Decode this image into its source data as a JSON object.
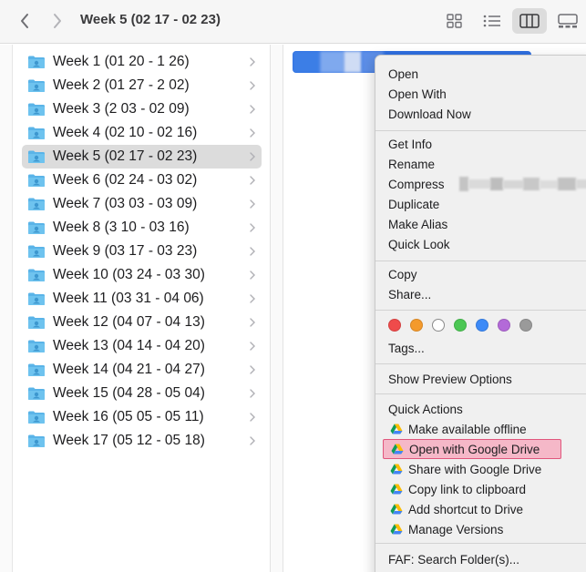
{
  "toolbar": {
    "title": "Week 5 (02 17 - 02 23)",
    "back_icon": "chevron-left-icon",
    "forward_icon": "chevron-right-icon",
    "view_modes": [
      "icon-view-icon",
      "list-view-icon",
      "column-view-icon",
      "gallery-view-icon"
    ],
    "active_view": "column-view-icon"
  },
  "folders": [
    {
      "label": "Week 1 (01 20 - 1 26)",
      "selected": false
    },
    {
      "label": "Week 2 (01 27 - 2 02)",
      "selected": false
    },
    {
      "label": "Week 3 (2 03 - 02 09)",
      "selected": false
    },
    {
      "label": "Week 4 (02 10 - 02 16)",
      "selected": false
    },
    {
      "label": "Week 5 (02 17 - 02 23)",
      "selected": true
    },
    {
      "label": "Week 6 (02 24 - 03 02)",
      "selected": false
    },
    {
      "label": "Week 7 (03 03 - 03 09)",
      "selected": false
    },
    {
      "label": "Week 8 (3 10 - 03 16)",
      "selected": false
    },
    {
      "label": "Week 9 (03 17 - 03 23)",
      "selected": false
    },
    {
      "label": "Week 10 (03 24 - 03 30)",
      "selected": false
    },
    {
      "label": "Week 11 (03 31 - 04 06)",
      "selected": false
    },
    {
      "label": "Week 12 (04 07 - 04 13)",
      "selected": false
    },
    {
      "label": "Week 13 (04 14 - 04 20)",
      "selected": false
    },
    {
      "label": "Week 14 (04 21 - 04 27)",
      "selected": false
    },
    {
      "label": "Week 15 (04 28 - 05 04)",
      "selected": false
    },
    {
      "label": "Week 16 (05 05 - 05 11)",
      "selected": false
    },
    {
      "label": "Week 17 (05 12 - 05 18)",
      "selected": false
    }
  ],
  "menu": {
    "open": "Open",
    "open_with": "Open With",
    "download_now": "Download Now",
    "get_info": "Get Info",
    "rename": "Rename",
    "compress": "Compress",
    "duplicate": "Duplicate",
    "make_alias": "Make Alias",
    "quick_look": "Quick Look",
    "copy": "Copy",
    "share": "Share...",
    "tags": "Tags...",
    "show_preview_options": "Show Preview Options",
    "quick_actions_title": "Quick Actions",
    "quick_actions": [
      {
        "label": "Make available offline",
        "highlighted": false
      },
      {
        "label": "Open with Google Drive",
        "highlighted": true
      },
      {
        "label": "Share with Google Drive",
        "highlighted": false
      },
      {
        "label": "Copy link to clipboard",
        "highlighted": false
      },
      {
        "label": "Add shortcut to Drive",
        "highlighted": false
      },
      {
        "label": "Manage Versions",
        "highlighted": false
      }
    ],
    "faf_search": "FAF: Search Folder(s)..."
  },
  "tag_colors": [
    {
      "name": "red",
      "color": "#ef4b4b"
    },
    {
      "name": "orange",
      "color": "#f49a2c"
    },
    {
      "name": "none",
      "color": "#ffffff"
    },
    {
      "name": "green",
      "color": "#4cc754"
    },
    {
      "name": "blue",
      "color": "#3d8af7"
    },
    {
      "name": "purple",
      "color": "#b36ad8"
    },
    {
      "name": "gray",
      "color": "#9a9a9a"
    }
  ],
  "colors": {
    "selection_blue": "#2f6fe0",
    "highlight_pink": "#f5b8c8",
    "highlight_border": "#e0567c",
    "folder_blue": "#5ab4e8"
  }
}
